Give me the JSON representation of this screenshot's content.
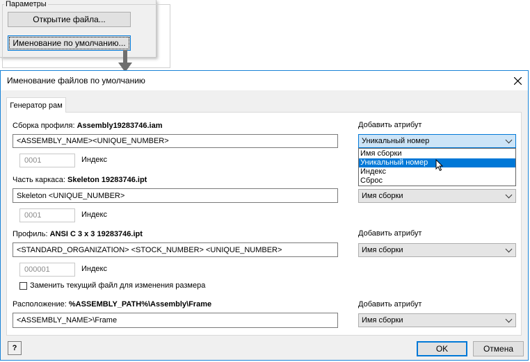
{
  "top_panel": {
    "group_title": "Параметры",
    "open_file_button": "Открытие файла...",
    "default_naming_button": "Именование по умолчанию..."
  },
  "dialog": {
    "title": "Именование файлов по умолчанию",
    "tab": "Генератор рам",
    "add_attribute_label": "Добавить атрибут",
    "index_label": "Индекс",
    "profile_assembly": {
      "label": "Сборка профиля:",
      "filename": "Assembly19283746.iam",
      "value": "<ASSEMBLY_NAME><UNIQUE_NUMBER>",
      "index": "0001",
      "combo_value": "Уникальный номер",
      "dropdown_options": [
        "Имя сборки",
        "Уникальный номер",
        "Индекс",
        "Сброс"
      ],
      "highlighted_option": "Уникальный номер"
    },
    "skeleton_part": {
      "label": "Часть каркаса:",
      "filename": "Skeleton 19283746.ipt",
      "value": "Skeleton <UNIQUE_NUMBER>",
      "index": "0001",
      "combo_value": "Имя сборки"
    },
    "profile": {
      "label": "Профиль:",
      "filename": "ANSI C 3 x 3 19283746.ipt",
      "value": "<STANDARD_ORGANIZATION> <STOCK_NUMBER> <UNIQUE_NUMBER>",
      "index": "000001",
      "combo_value": "Имя сборки"
    },
    "replace_checkbox": {
      "label": "Заменить текущий файл для изменения размера",
      "checked": false
    },
    "location": {
      "label": "Расположение:",
      "filename": "%ASSEMBLY_PATH%\\Assembly\\Frame",
      "value": "<ASSEMBLY_NAME>\\Frame",
      "combo_value": "Имя сборки"
    },
    "help_icon_glyph": "?",
    "ok_button": "OK",
    "cancel_button": "Отмена"
  },
  "colors": {
    "accent": "#0078d7",
    "selection": "#cce4f7",
    "highlight": "#0078d7",
    "tab_border": "#d9d9d9"
  }
}
